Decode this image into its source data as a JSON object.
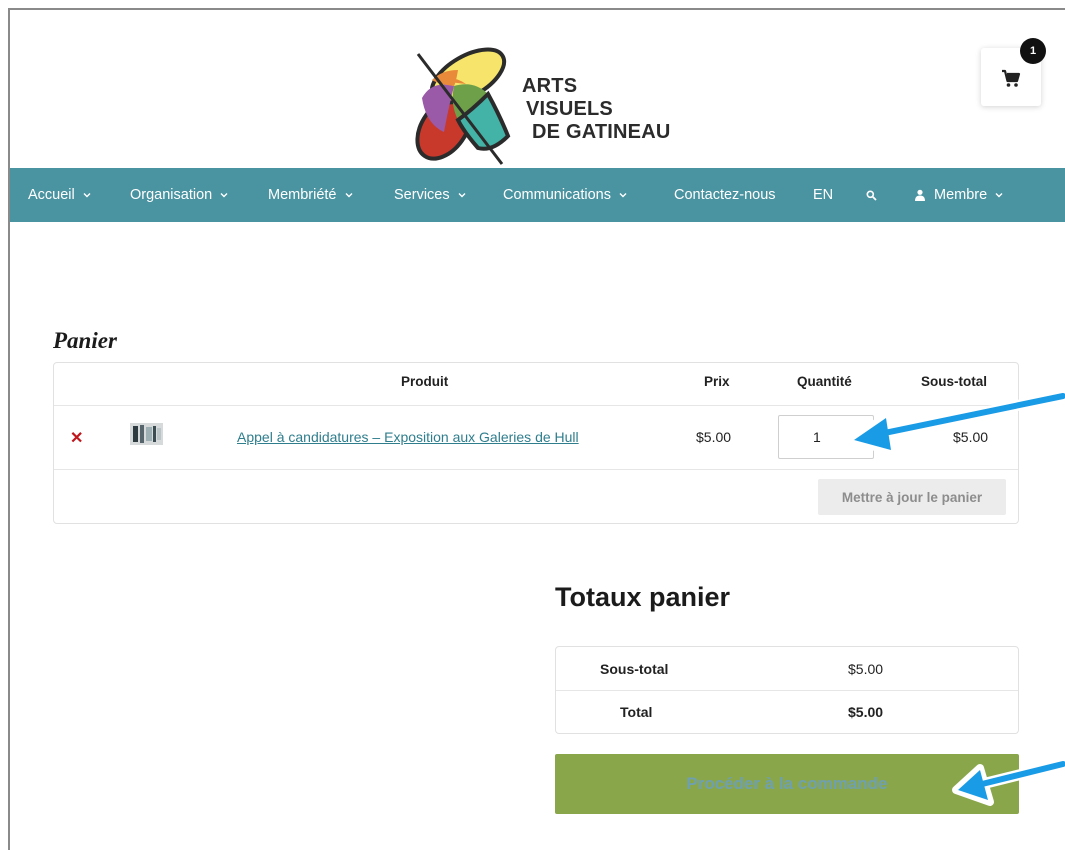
{
  "header": {
    "logo_line1": "ARTS",
    "logo_line2": "VISUELS",
    "logo_line3": "DE GATINEAU",
    "cart_count": "1"
  },
  "nav": {
    "items": [
      {
        "label": "Accueil",
        "has_dropdown": true
      },
      {
        "label": "Organisation",
        "has_dropdown": true
      },
      {
        "label": "Membriété",
        "has_dropdown": true
      },
      {
        "label": "Services",
        "has_dropdown": true
      },
      {
        "label": "Communications",
        "has_dropdown": true
      },
      {
        "label": "Contactez-nous",
        "has_dropdown": false
      },
      {
        "label": "EN",
        "has_dropdown": false
      },
      {
        "label": "Membre",
        "has_dropdown": true
      }
    ],
    "background": "#4a93a0"
  },
  "cart": {
    "title": "Panier",
    "columns": {
      "product": "Produit",
      "price": "Prix",
      "quantity": "Quantité",
      "subtotal": "Sous-total"
    },
    "items": [
      {
        "product": "Appel à candidatures – Exposition aux Galeries de Hull",
        "price": "$5.00",
        "quantity": "1",
        "subtotal": "$5.00"
      }
    ],
    "update_label": "Mettre à jour le panier"
  },
  "totals": {
    "title": "Totaux panier",
    "subtotal_label": "Sous-total",
    "subtotal_value": "$5.00",
    "total_label": "Total",
    "total_value": "$5.00",
    "checkout_label": "Procéder à la commande"
  },
  "colors": {
    "accent": "#4a93a0",
    "checkout": "#8aa64b",
    "remove": "#c0161c",
    "annotation_arrow": "#1a9be6"
  }
}
